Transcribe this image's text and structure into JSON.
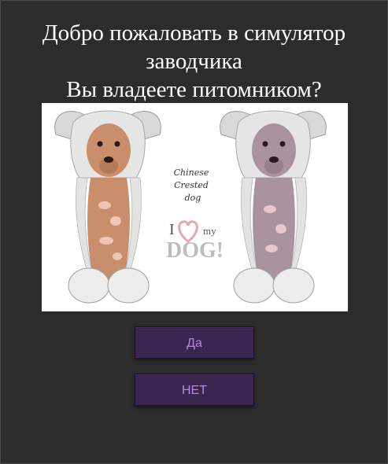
{
  "welcome": {
    "line1": "Добро пожаловать в симулятор",
    "line2": "заводчика",
    "question": "Вы владеете питомником?"
  },
  "illustration": {
    "script_line1": "Chinese",
    "script_line2": "Crested",
    "script_line3": "dog",
    "slogan_i": "I",
    "slogan_my": "my",
    "slogan_dog": "DOG!"
  },
  "buttons": {
    "yes_label": "Да",
    "no_label": "НЕТ"
  },
  "colors": {
    "background": "#2c2c2c",
    "button_bg": "#3a2550",
    "button_text": "#b489d6",
    "heart": "#e8a7b3"
  }
}
